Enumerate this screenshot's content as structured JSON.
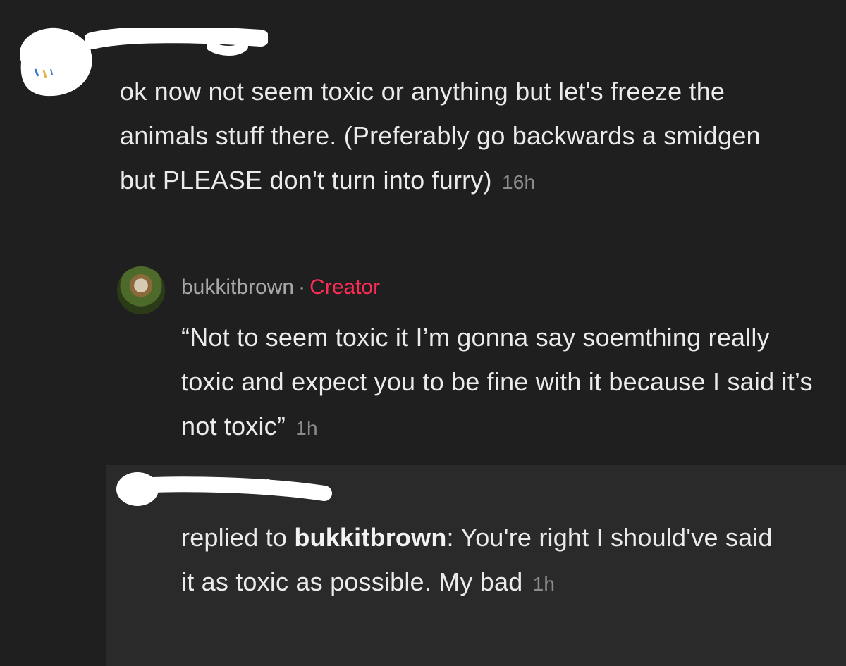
{
  "comments": [
    {
      "text": "ok now not seem toxic or anything but let's freeze the animals stuff there. (Preferably go backwards a smidgen but PLEASE don't turn into furry)",
      "timestamp": "16h"
    }
  ],
  "replies": [
    {
      "username": "bukkitbrown",
      "separator": "·",
      "badge": "Creator",
      "text": "“Not to seem toxic it I’m gonna say soemthing really toxic and expect you to be fine with it because I said it’s not toxic”",
      "timestamp": "1h"
    },
    {
      "replied_prefix": "replied to",
      "replied_to": "bukkitbrown",
      "replied_colon": ":",
      "text": "You're right I should've said it as toxic as possible. My bad",
      "timestamp": "1h"
    }
  ],
  "colors": {
    "background": "#1f1f1f",
    "reply_highlight": "#2a2a2a",
    "text": "#ebebeb",
    "muted": "#8c8c8c",
    "creator_badge": "#fe2c55"
  }
}
